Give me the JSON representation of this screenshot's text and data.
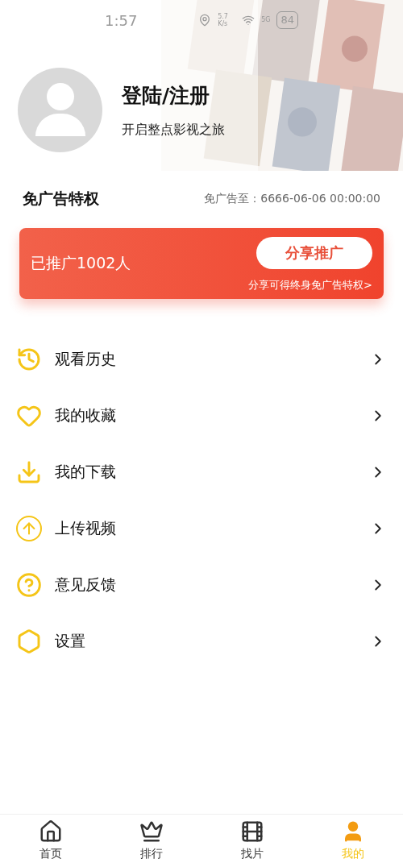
{
  "status_bar": {
    "time": "1:57",
    "speed": "5.7 K/s",
    "network": "5G",
    "battery": "84"
  },
  "profile": {
    "title": "登陆/注册",
    "subtitle": "开启整点影视之旅"
  },
  "privilege": {
    "title": "免广告特权",
    "expiry": "免广告至：6666-06-06 00:00:00"
  },
  "promo_card": {
    "count_text": "已推广1002人",
    "button": "分享推广",
    "hint": "分享可得终身免广告特权>"
  },
  "menu": [
    {
      "kind": "history",
      "label": "观看历史"
    },
    {
      "kind": "favorite",
      "label": "我的收藏"
    },
    {
      "kind": "download",
      "label": "我的下载"
    },
    {
      "kind": "upload",
      "label": "上传视频"
    },
    {
      "kind": "feedback",
      "label": "意见反馈"
    },
    {
      "kind": "settings",
      "label": "设置"
    }
  ],
  "tab_bar": [
    {
      "kind": "home",
      "label": "首页",
      "selected": false
    },
    {
      "kind": "rank",
      "label": "排行",
      "selected": false
    },
    {
      "kind": "discover",
      "label": "找片",
      "selected": false
    },
    {
      "kind": "mine",
      "label": "我的",
      "selected": true
    }
  ]
}
